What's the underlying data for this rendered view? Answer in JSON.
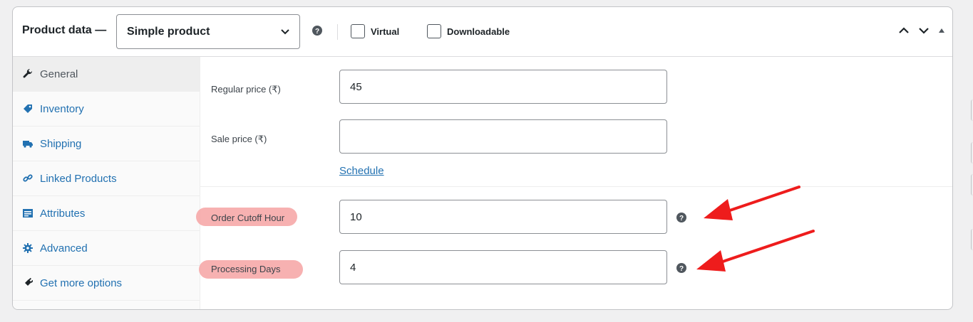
{
  "header": {
    "title": "Product data —",
    "product_type": "Simple product",
    "virtual_label": "Virtual",
    "downloadable_label": "Downloadable"
  },
  "sidebar": {
    "items": [
      {
        "label": "General",
        "icon": "wrench-icon",
        "active": true
      },
      {
        "label": "Inventory",
        "icon": "tag-icon"
      },
      {
        "label": "Shipping",
        "icon": "truck-icon"
      },
      {
        "label": "Linked Products",
        "icon": "link-icon"
      },
      {
        "label": "Attributes",
        "icon": "list-icon"
      },
      {
        "label": "Advanced",
        "icon": "gear-icon"
      },
      {
        "label": "Get more options",
        "icon": "plugin-icon"
      }
    ]
  },
  "pricing": {
    "regular_label": "Regular price (₹)",
    "regular_value": "45",
    "sale_label": "Sale price (₹)",
    "sale_value": "",
    "schedule_link": "Schedule"
  },
  "custom": {
    "cutoff_label": "Order Cutoff Hour",
    "cutoff_value": "10",
    "processing_label": "Processing Days",
    "processing_value": "4"
  },
  "colors": {
    "link": "#2271b1",
    "highlight": "#f6a3a3",
    "arrow": "#ee1c1c"
  }
}
